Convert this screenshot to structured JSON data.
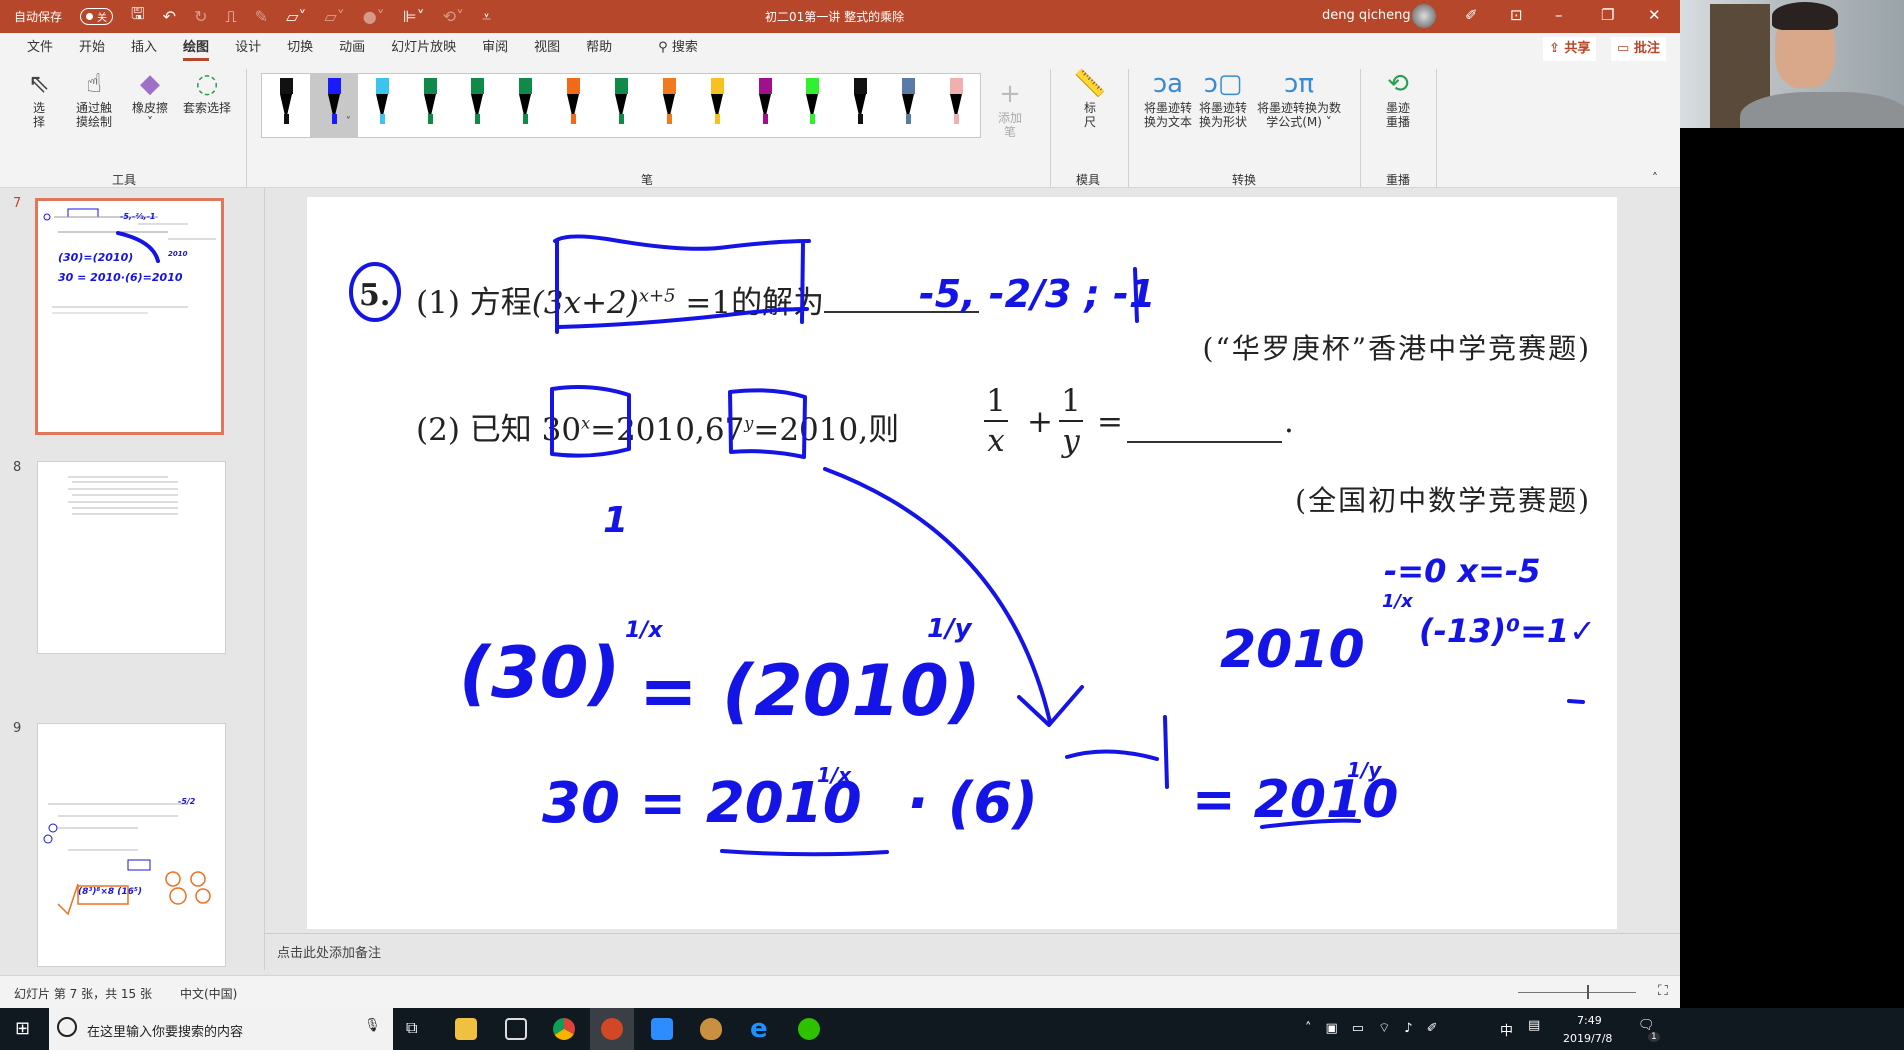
{
  "titlebar": {
    "autosave_label": "自动保存",
    "autosave_state": "关",
    "doc_title": "初二01第一讲 整式的乘除",
    "user_name": "deng qicheng"
  },
  "menu": {
    "tabs": [
      "文件",
      "开始",
      "插入",
      "绘图",
      "设计",
      "切换",
      "动画",
      "幻灯片放映",
      "审阅",
      "视图",
      "帮助"
    ],
    "active": "绘图",
    "search": "搜索",
    "share": "共享",
    "comment": "批注"
  },
  "ribbon": {
    "tools": {
      "select": "选择",
      "touch_draw": "通过触摸绘制",
      "eraser": "橡皮擦",
      "lasso": "套索选择",
      "group": "工具"
    },
    "pens": {
      "group": "笔",
      "colors": [
        "#111111",
        "#1a1aff",
        "#3cc4f0",
        "#0f8a4a",
        "#0f8a4a",
        "#0f8a4a",
        "#f06a1a",
        "#0f8a4a",
        "#f07a20",
        "#f8c020",
        "#a0108a",
        "#30f030",
        "#111111",
        "#5a7aa8",
        "#f0b0b0"
      ],
      "selected": 1,
      "add_pen": "添加笔"
    },
    "stencils": {
      "ruler": "标尺",
      "group": "模具"
    },
    "convert": {
      "ink_to_text": "将墨迹转换为文本",
      "ink_to_shape": "将墨迹转换为形状",
      "ink_to_math": "将墨迹转换为数学公式(M)",
      "group": "转换"
    },
    "replay": {
      "ink_replay": "墨迹重播",
      "group": "重播"
    }
  },
  "thumbnails": [
    {
      "number": "7",
      "selected": true
    },
    {
      "number": "8",
      "selected": false
    },
    {
      "number": "9",
      "selected": false
    }
  ],
  "slide": {
    "number": "5.",
    "q1_prefix": "(1) 方程",
    "q1_equation": "(3x+2)",
    "q1_exponent": "x+5",
    "q1_rhs": "=1",
    "q1_suffix": "的解为",
    "q1_source": "(“华罗庚杯”香港中学竞赛题)",
    "q2_prefix": "(2) 已知",
    "q2_a": "30",
    "q2_a_exp": "x",
    "q2_mid": "=2010,",
    "q2_b": "67",
    "q2_b_exp": "y",
    "q2_rest": "=2010,则",
    "q2_frac_num": "1",
    "q2_frac_x": "x",
    "q2_frac_y": "y",
    "q2_plus": "+",
    "q2_eq": "=",
    "q2_end": ".",
    "q2_source": "(全国初中数学竞赛题)",
    "ink": {
      "answer1": "-5, -2/3 ; -1",
      "eq1_left": "(30)",
      "eq1_right": "= (2010)",
      "eq2_left": "30 = 2010",
      "eq2_mid": "· (6)",
      "eq2_right": "= 2010",
      "side1": "2010",
      "side2": "-=0  x=-5",
      "side3": "(-13)⁰=1✓",
      "one": "1",
      "frac_x": "1/x",
      "frac_y": "1/y"
    }
  },
  "notes": {
    "placeholder": "点击此处添加备注"
  },
  "status": {
    "slide_info": "幻灯片 第 7 张，共 15 张",
    "language": "中文(中国)"
  },
  "taskbar": {
    "search_placeholder": "在这里输入你要搜索的内容",
    "time": "7:49",
    "date": "2019/7/8",
    "ime": "中",
    "notif_count": "1"
  }
}
